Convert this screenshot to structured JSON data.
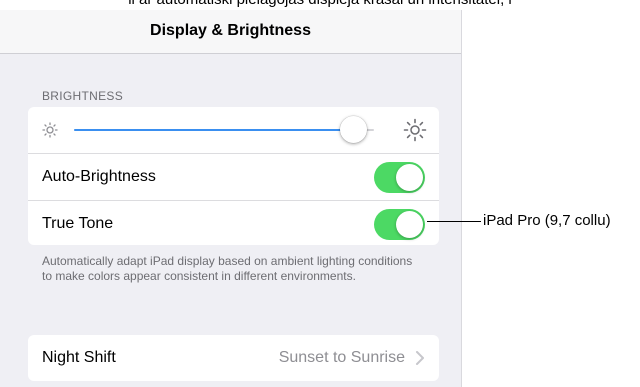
{
  "caption": {
    "top_text": "li ar automātiski pielāgojas displeja krāsai un intensitātei, l"
  },
  "navbar": {
    "title": "Display & Brightness"
  },
  "brightness": {
    "section_header": "BRIGHTNESS",
    "level": 0.93,
    "icon_low": "sun-small-icon",
    "icon_high": "sun-large-icon",
    "accent_color": "#3a8ff0"
  },
  "settings": {
    "auto_brightness": {
      "label": "Auto-Brightness",
      "on": true
    },
    "true_tone": {
      "label": "True Tone",
      "on": true
    },
    "toggle_color": "#4cd964"
  },
  "footer": {
    "text": "Automatically adapt iPad display based on ambient lighting conditions to make colors appear consistent in different environments."
  },
  "night_shift": {
    "label": "Night Shift",
    "value": "Sunset to Sunrise",
    "icon": "chevron-right-icon"
  },
  "callout": {
    "text": "iPad Pro (9,7 collu)"
  }
}
